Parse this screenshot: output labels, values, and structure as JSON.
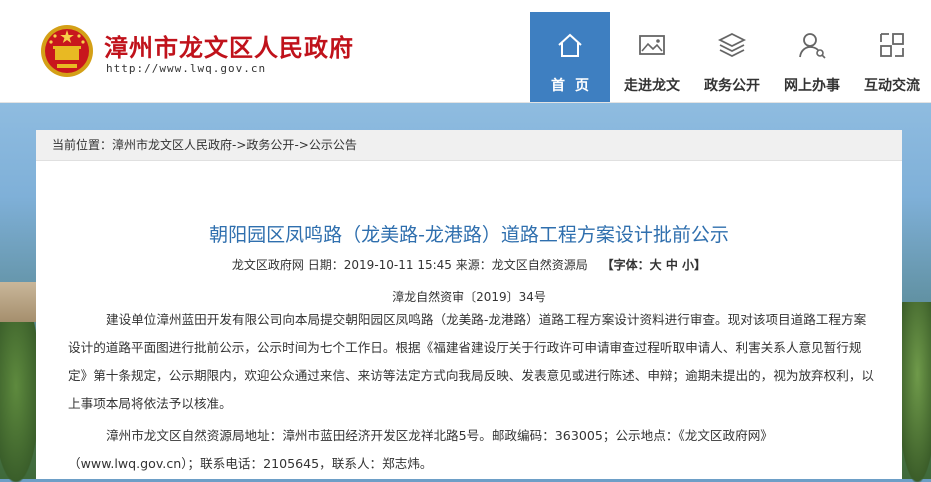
{
  "header": {
    "site_title": "漳州市龙文区人民政府",
    "site_url": "http://www.lwq.gov.cn"
  },
  "nav": {
    "items": [
      {
        "label": "首页",
        "icon": "home-icon",
        "active": true
      },
      {
        "label": "走进龙文",
        "icon": "picture-icon"
      },
      {
        "label": "政务公开",
        "icon": "layers-icon"
      },
      {
        "label": "网上办事",
        "icon": "user-search-icon"
      },
      {
        "label": "互动交流",
        "icon": "interaction-icon"
      }
    ]
  },
  "breadcrumb": {
    "prefix": "当前位置：",
    "items": [
      "漳州市龙文区人民政府",
      "政务公开",
      "公示公告"
    ],
    "separator": "->"
  },
  "article": {
    "title": "朝阳园区凤鸣路（龙美路-龙港路）道路工程方案设计批前公示",
    "source_site": "龙文区政府网",
    "date_label": "日期：",
    "date": "2019-10-11 15:45",
    "source_label": "来源：",
    "source": "龙文区自然资源局",
    "font_size_label": "【字体：",
    "font_sizes": [
      "大",
      "中",
      "小"
    ],
    "font_size_end": "】",
    "doc_number": "漳龙自然资审〔2019〕34号",
    "paragraph1": "建设单位漳州蓝田开发有限公司向本局提交朝阳园区凤鸣路（龙美路-龙港路）道路工程方案设计资料进行审查。现对该项目道路工程方案设计的道路平面图进行批前公示，公示时间为七个工作日。根据《福建省建设厅关于行政许可申请审查过程听取申请人、利害关系人意见暂行规定》第十条规定，公示期限内，欢迎公众通过来信、来访等法定方式向我局反映、发表意见或进行陈述、申辩；逾期未提出的，视为放弃权利，以上事项本局将依法予以核准。",
    "paragraph2": "漳州市龙文区自然资源局地址：漳州市蓝田经济开发区龙祥北路5号。邮政编码：363005；公示地点：《龙文区政府网》（www.lwq.gov.cn）；联系电话：2105645，联系人：郑志炜。"
  },
  "colors": {
    "title_red": "#c0121b",
    "nav_active": "#3e7fc1",
    "article_title_blue": "#2f6fae"
  }
}
